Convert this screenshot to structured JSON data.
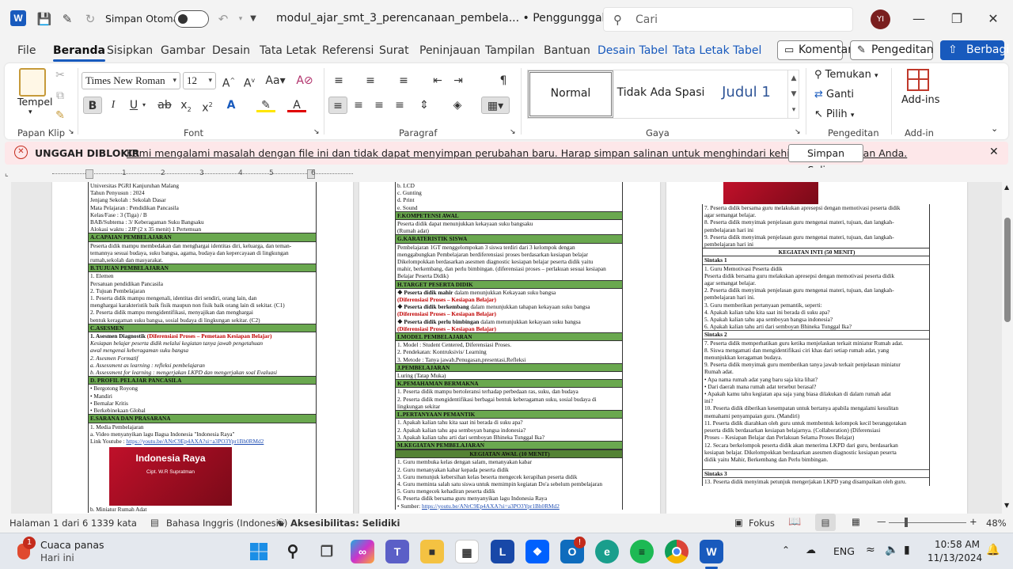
{
  "titlebar": {
    "app_logo": "W",
    "autosave_label": "Simpan Otomatis",
    "doc_title": "modul_ajar_smt_3_perencanaan_pembela... • Penggunggahan Diblokir",
    "search_placeholder": "Cari",
    "avatar_initials": "YI"
  },
  "menu": {
    "tabs": [
      "File",
      "Beranda",
      "Sisipkan",
      "Gambar",
      "Desain",
      "Tata Letak",
      "Referensi",
      "Surat",
      "Peninjauan",
      "Tampilan",
      "Bantuan",
      "Desain Tabel",
      "Tata Letak Tabel"
    ],
    "comment_label": "Komentar",
    "editing_label": "Pengeditan",
    "share_label": "Berbagi"
  },
  "ribbon": {
    "clipboard": {
      "paste_label": "Tempel",
      "group": "Papan Klip"
    },
    "font": {
      "name": "Times New Roman",
      "size": "12",
      "group": "Font"
    },
    "paragraph": {
      "group": "Paragraf"
    },
    "styles": {
      "items": [
        "Normal",
        "Tidak Ada Spasi",
        "Judul 1"
      ],
      "group": "Gaya"
    },
    "editing": {
      "find": "Temukan",
      "replace": "Ganti",
      "select": "Pilih",
      "group": "Pengeditan"
    },
    "addins": {
      "label": "Add-ins",
      "group": "Add-in"
    }
  },
  "message_bar": {
    "title": "UNGGAH DIBLOKIR",
    "text": "Kami mengalami masalah dengan file ini dan tidak dapat menyimpan perubahan baru. Harap simpan salinan untuk menghindari kehilangan pekerjaan Anda.",
    "button": "Simpan Salinan"
  },
  "ruler": {
    "marks": [
      "1",
      "2",
      "3",
      "4",
      "5",
      "6"
    ]
  },
  "page1": {
    "info": [
      "Universitas PGRI Kanjuruhan Malang",
      "Tahun Penyusun      : 2024",
      "Jenjang Sekolah      : Sekolah Dasar",
      "Mata Pelajaran        : Pendidikan Pancasila",
      "Kelas/Fase              : 3 (Tiga) / B",
      "BAB/Subtema          : 3/ Keberagaman Suku Bangsaku",
      "Alokasi waktu          : 2JP (2 x 35 menit) 1 Pertemuan"
    ],
    "sec_a": "A.CAPAIAN PEMBELAJARAN",
    "sec_a_text": [
      "Peserta didik mampu membedakan dan menghargai identitas diri, keluarga, dan teman-",
      "temannya sesuai budaya, suku bangsa, agama, budaya dan kepercayaan di lingkungan",
      "rumah,sekolah dan masyarakat."
    ],
    "sec_b": "B.TUJUAN PEMBELAJARAN",
    "sec_b_lines": [
      "1.   Elemen",
      "      Persatuan pendidikan Pancasila",
      "",
      "2.   Tujuan Pembelajaran",
      "      1.   Peserta didik mampu mengenali, identitas diri sendiri, orang lain, dan",
      "            menghargai karakteristik baik fisik maupun non fisik baik orang lain di sekitar. (C1)",
      "      2.   Peserta didik mampu mengidentifikasi, menyajikan dan menghargai",
      "            bentuk keragaman suku bangsa, sosial budaya di lingkungan sekitar. (C2)"
    ],
    "sec_c": "C.ASESMEN",
    "sec_c_diag": "1.  Asesmen Diagnostik",
    "sec_c_diag_red": "(Diferensiasi Proses – Pemetaan Kesiapan Belajar)",
    "sec_c_lines": [
      "      Kesiapan  belajar  peserta  didik  melalui  kegiatan  tanya jawab pengetahuan",
      "      awal mengenai keberagaman suku bangsa",
      "2.  Asesmen Formatif",
      "      a.  Assessment as learning : refleksi pembelajaran",
      "      b.  Assessment for learning : mengerjakan LKPD dan mengerjakan soal Evaluasi"
    ],
    "sec_d": "D. PROFIL PELAJAR PANCASILA",
    "sec_d_lines": [
      "  •  Bergotong Royong",
      "  •  Mandiri",
      "  •  Bernalar Kritis",
      "  •  Berkebinekaan Global"
    ],
    "sec_e": "E.SARANA DAN PRASARANA",
    "sec_e_lines": [
      "1.  Media Pembelajaran",
      "      a.   Video menyanyikan lagu Bagsa Indonesia \"Indonesia Raya\""
    ],
    "sec_e_link_label": "             Link Youtube : ",
    "sec_e_link": "https://youtu.be/ANrC9Ep4AXA?si=a3PO3Ypr1Bh0RMd2",
    "image_title": "Indonesia Raya",
    "image_sub": "Cipt. W.R Supratman",
    "sec_e_after": "      b.   Miniatur Rumah Adat"
  },
  "page2": {
    "top_lines": [
      "      b.  LCD",
      "      c.  Gunting",
      "      d.  Print",
      "      e.  Sound"
    ],
    "sec_f": "F.KOMPETENSI AWAL",
    "sec_f_text": [
      "Peserta didik dapat menunjukkan kekayaan suku bangsaku",
      "(Rumah adat)"
    ],
    "sec_g": "G.KARATERISTIK SISWA",
    "sec_g_text": [
      "Pembelajaran 1GT menggelompokan 3 siswa terdiri dari 3 kelompok dengan",
      "menggabungkan  Pembelajaran berdiferensiasi proses berdasarkan kesiapan belajar",
      "Dikelompokkan berdasarkan asesmen diagnostic kesiapan belajar peserta didik yaitu",
      "mahir, berkembang, dan perlu bimbingan. (diferensiasi proses – perlakuan sesuai kesiapan",
      "Belajar Peserta Didik)"
    ],
    "sec_h": "H.TARGET PESERTA DIDIK",
    "sec_h_lines": [
      {
        "a": "  ❖  Peserta didik mahir",
        "b": " dalam menunjukkan Kekayaan suku bangsa",
        "r": "      (Diferensiasi Proses – Kesiapan Belajar)"
      },
      {
        "a": "  ❖  Peserta didik berkembang",
        "b": " dalam menunjukkan tahapan kekayaan suku bangsa",
        "r": "      (Diferensiasi Proses – Kesiapan Belajar)"
      },
      {
        "a": "  ❖  Peserta didik perlu bimbingan",
        "b": " dalam menunjukkan kekayaan suku bangsa",
        "r": "      (Diferensiasi Proses – Kesiapan Belajar)"
      }
    ],
    "sec_i": "I.MODEL PEMBELAJARAN",
    "sec_i_lines": [
      "   1.  Model : Student Centered, Diferensiasi Proses.",
      "   2.  Pendekatan: Kontruksivis/ Learning",
      "   3.  Metode : Tanya jawab,Penugasan,presentasi,Refleksi"
    ],
    "sec_j": "J.PEMBELAJARAN",
    "sec_j_text": [
      "Luring (Tatap Muka)"
    ],
    "sec_k": "K.PEMAHAMAN BERMAKNA",
    "sec_k_lines": [
      "   1.  Peserta didik mampu bertoleransi terhadap perbedaan ras, suku, dan budaya",
      "   2.  Peserta didik mengidentifikasi berbagai bentuk keberagaman suku, sosial budaya di",
      "        lingkungan sekitar"
    ],
    "sec_l": "L.PERTANYAAN PEMANTIK",
    "sec_l_lines": [
      "   1.  Apakah kalian tahu kita saat ini berada di suku apa?",
      "   2.  Apakah kalian tahu apa semboyan bangsa indonesia?",
      "   3.  Apakah kalian tahu arti dari semboyan Bhineka Tunggal Ika?"
    ],
    "sec_m": "M.KEGIATAN PEMBELAJARAN",
    "sec_m_sub": "KEGIATAN AWAL (10 MENIT)",
    "sec_m_lines": [
      "   1.  Guru membuka kelas dengan salam, menanyakan kabar",
      "   2.  Guru menanyakan kabar kepada peserta didik",
      "   3.  Guru menunjuk kebersihan kelas beserta mengecek kerapihan peserta didik",
      "   4.  Guru meminta salah satu siswa untuk memimpin kegiatan Do'a sebelum pembelajaran",
      "   5.  Guru mengecek kehadiran peserta didik",
      "   6.  Peserta didik bersama guru menyanyikan lagu Indonesia Raya"
    ],
    "sec_m_link_label": "   •  Sumber: ",
    "sec_m_link": "https://youtu.be/ANrC9Ep4AXA?si=a3PO3Ypr1Bh0RMd2"
  },
  "page3": {
    "top_lines": [
      "   7.  Peserta didik bersama guru melakukan apresepsi dengan memotivasi peserta didik",
      "        agar semangat belajar.",
      "   8.  Peserta didik menyimak penjelasan guru mengenai materi, tujuan, dan langkah-",
      "        pembelajaran hari ini",
      "   9.  Peserta didik menyimak penjelasan guru mengenai materi, tujuan, dan langkah-",
      "        pembelajaran hari ini"
    ],
    "inti": "KEGIATAN INTI (50 MENIT)",
    "s1": "Sintaks 1",
    "s1_lines": [
      "   1.  Guru Memotivasi Peserta didik",
      "        Peserta didik bersama guru melakukan apresepsi dengan memotivasi peserta didik",
      "        agar semangat belajar.",
      "   2.  Peserta didik menyimak penjelasan guru mengenai materi, tujuan, dan langkah-",
      "        pembelajaran hari ini.",
      "   3.  Guru memberikan pertanyaan pemantik, seperti:",
      "   4.  Apakah kalian tahu kita saat ini berada di suku apa?",
      "   5.  Apakah kalian tahu apa semboyan bangsa indonesia?",
      "   6.  Apakah kalian tahu arti dari semboyan Bhineka Tunggal Ika?"
    ],
    "s2": "Sintaks 2",
    "s2_lines": [
      "   7.  Peserta didik memperhatikan guru ketika menjelaskan terkait miniatur Rumah adat.",
      "   8.  Siswa mengamati dan mengidentifikasi ciri khas dari setiap rumah adat, yang",
      "        menunjukkan keragaman budaya.",
      "   9.  Peserta didik menyimak guru memberikan tanya jawab terkait penjelasan miniatur",
      "        Rumah adat.",
      "              •  Apa nama rumah adat yang baru saja kita lihat?",
      "              •  Dari daerah mana rumah adat tersebut berasal?",
      "              •  Apakah kamu tahu kegiatan apa saja yang biasa dilakukan di dalam rumah adat",
      "                  ini?",
      "   10. Peserta didik diberikan kesempatan untuk bertanya apabila mengalami kesulitan",
      "        memahami penyampaian guru. (Mandiri)",
      "   11. Peserta didik diarahkan oleh guru untuk membentuk kelompok kecil beranggotakan",
      "        peserta didik berdasarkan kesiapan belajarnya. (Collaboration) (Diferensiasi",
      "        Proses – Kesiapan Belajar dan Perlakuan Selama Proses Belajar)",
      "   12. Secara berkelompok peserta didik akan menerima LKPD dari guru, berdasarkan",
      "        kesiapan belajar. Dikelompokkan berdasarkan asesmen diagnostic kesiapan peserta",
      "        didik yaitu Mahir, Berkembang dan Perlu bimbingan."
    ],
    "s3": "Sintaks 3",
    "s3_lines": [
      "   13. Peserta didik menyimak petunjuk mengerjakan LKPD yang disampaikan oleh guru."
    ]
  },
  "status": {
    "page": "Halaman 1 dari 6",
    "words": "1339 kata",
    "language": "Bahasa Inggris (Indonesia)",
    "accessibility": "Aksesibilitas: Selidiki",
    "focus": "Fokus",
    "zoom": "48%"
  },
  "taskbar": {
    "weather_title": "Cuaca panas",
    "weather_sub": "Hari ini",
    "weather_badge": "1",
    "lang": "ENG",
    "time": "10:58 AM",
    "date": "11/13/2024"
  },
  "colors": {
    "accent": "#185abd",
    "section_green": "#6aa84f",
    "error_bg": "#fde7e9"
  }
}
